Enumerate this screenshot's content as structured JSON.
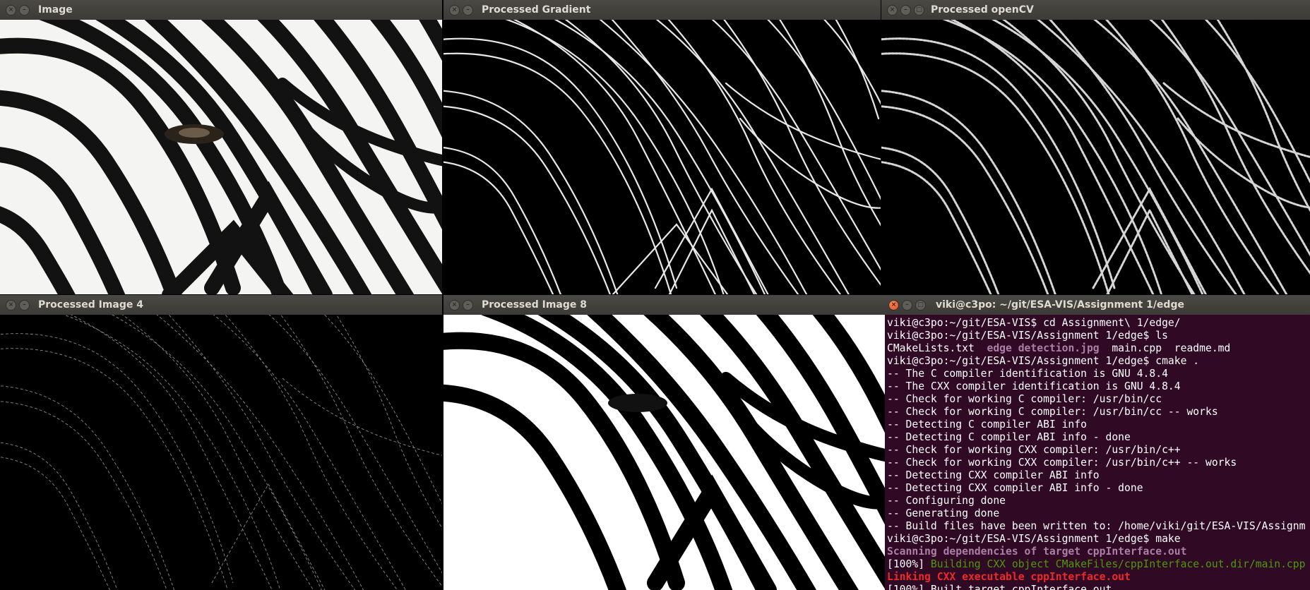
{
  "windows": {
    "image": {
      "title": "Image"
    },
    "gradient": {
      "title": "Processed Gradient"
    },
    "opencv": {
      "title": "Processed openCV"
    },
    "image4": {
      "title": "Processed Image 4"
    },
    "image8": {
      "title": "Processed Image 8"
    },
    "terminal": {
      "title": "viki@c3po: ~/git/ESA-VIS/Assignment 1/edge",
      "lines": [
        {
          "text": "viki@c3po:~/git/ESA-VIS$ cd Assignment\\ 1/edge/",
          "style": "plain"
        },
        {
          "text": "viki@c3po:~/git/ESA-VIS/Assignment 1/edge$ ls",
          "style": "plain"
        },
        {
          "text": "",
          "style": "ls"
        },
        {
          "text": "viki@c3po:~/git/ESA-VIS/Assignment 1/edge$ cmake .",
          "style": "plain"
        },
        {
          "text": "-- The C compiler identification is GNU 4.8.4",
          "style": "plain"
        },
        {
          "text": "-- The CXX compiler identification is GNU 4.8.4",
          "style": "plain"
        },
        {
          "text": "-- Check for working C compiler: /usr/bin/cc",
          "style": "plain"
        },
        {
          "text": "-- Check for working C compiler: /usr/bin/cc -- works",
          "style": "plain"
        },
        {
          "text": "-- Detecting C compiler ABI info",
          "style": "plain"
        },
        {
          "text": "-- Detecting C compiler ABI info - done",
          "style": "plain"
        },
        {
          "text": "-- Check for working CXX compiler: /usr/bin/c++",
          "style": "plain"
        },
        {
          "text": "-- Check for working CXX compiler: /usr/bin/c++ -- works",
          "style": "plain"
        },
        {
          "text": "-- Detecting CXX compiler ABI info",
          "style": "plain"
        },
        {
          "text": "-- Detecting CXX compiler ABI info - done",
          "style": "plain"
        },
        {
          "text": "-- Configuring done",
          "style": "plain"
        },
        {
          "text": "-- Generating done",
          "style": "plain"
        },
        {
          "text": "-- Build files have been written to: /home/viki/git/ESA-VIS/Assignm",
          "style": "plain"
        },
        {
          "text": "viki@c3po:~/git/ESA-VIS/Assignment 1/edge$ make",
          "style": "plain"
        },
        {
          "text": "Scanning dependencies of target cppInterface.out",
          "style": "scan"
        },
        {
          "text": "",
          "style": "build"
        },
        {
          "text": "Linking CXX executable cppInterface.out",
          "style": "link"
        },
        {
          "text": "[100%] Built target cppInterface.out",
          "style": "plain"
        }
      ],
      "ls": {
        "file1": "CMakeLists.txt",
        "file2": "edge detection.jpg",
        "file3": "main.cpp",
        "file4": "readme.md"
      },
      "build": {
        "prefix": "[100%] ",
        "text": "Building CXX object CMakeFiles/cppInterface.out.dir/main.cpp"
      }
    }
  },
  "colors": {
    "terminal_bg": "#300a24",
    "titlebar": "#3c3b37",
    "close_active": "#df4b16"
  }
}
